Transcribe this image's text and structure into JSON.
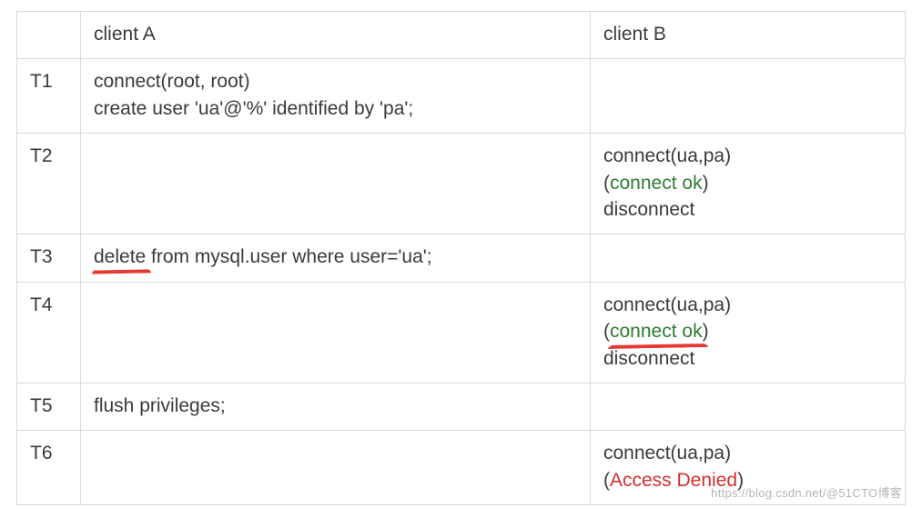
{
  "header": {
    "step": "",
    "clientA": "client A",
    "clientB": "client B"
  },
  "rows": {
    "t1": {
      "step": "T1",
      "a_line1": "connect(root, root)",
      "a_line2": "create user 'ua'@'%' identified by 'pa';",
      "b": ""
    },
    "t2": {
      "step": "T2",
      "a": "",
      "b_line1": "connect(ua,pa)",
      "b_line2_open": "(",
      "b_line2_status": "connect ok",
      "b_line2_close": ")",
      "b_line3": "disconnect"
    },
    "t3": {
      "step": "T3",
      "a_part1": "delete",
      "a_part2": " from mysql.user where user='ua';",
      "b": ""
    },
    "t4": {
      "step": "T4",
      "a": "",
      "b_line1": "connect(ua,pa)",
      "b_line2_open": "(",
      "b_line2_status": "connect ok",
      "b_line2_close": ")",
      "b_line3": "disconnect"
    },
    "t5": {
      "step": "T5",
      "a": "flush privileges;",
      "b": ""
    },
    "t6": {
      "step": "T6",
      "a": "",
      "b_line1": "connect(ua,pa)",
      "b_line2_open": "(",
      "b_line2_status": "Access Denied",
      "b_line2_close": ")"
    }
  },
  "watermark": "https://blog.csdn.net/@51CTO博客"
}
